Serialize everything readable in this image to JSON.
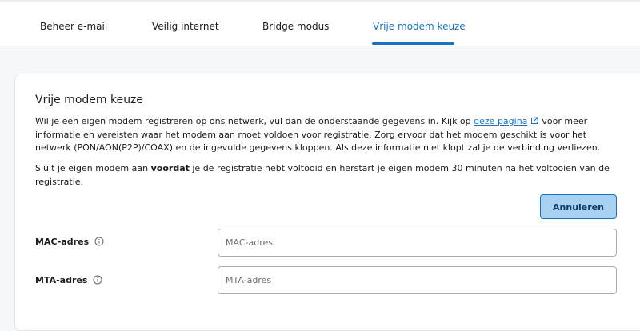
{
  "tabs": [
    {
      "label": "Beheer e-mail"
    },
    {
      "label": "Veilig internet"
    },
    {
      "label": "Bridge modus"
    },
    {
      "label": "Vrije modem keuze",
      "active": true
    }
  ],
  "panel": {
    "title": "Vrije modem keuze",
    "paragraph1": {
      "before_link": "Wil je een eigen modem registreren op ons netwerk, vul dan de onderstaande gegevens in. Kijk op ",
      "link_text": "deze pagina",
      "after_link": "voor meer informatie en vereisten waar het modem aan moet voldoen voor registratie. Zorg ervoor dat het modem geschikt is voor het netwerk (PON/AON(P2P)/COAX) en de ingevulde gegevens kloppen. Als deze informatie niet klopt zal je de verbinding verliezen."
    },
    "paragraph2": {
      "before_bold": "Sluit je eigen modem aan ",
      "bold": "voordat",
      "after_bold": " je de registratie hebt voltooid en herstart je eigen modem 30 minuten na het voltooien van de registratie."
    },
    "cancel_label": "Annuleren",
    "fields": [
      {
        "label": "MAC-adres",
        "placeholder": "MAC-adres",
        "value": ""
      },
      {
        "label": "MTA-adres",
        "placeholder": "MTA-adres",
        "value": ""
      }
    ]
  },
  "colors": {
    "accent": "#1b72c0",
    "button_bg": "#a9d1f2",
    "page_bg": "#f6f7f8"
  },
  "icons": [
    "external-link-icon",
    "info-icon"
  ]
}
